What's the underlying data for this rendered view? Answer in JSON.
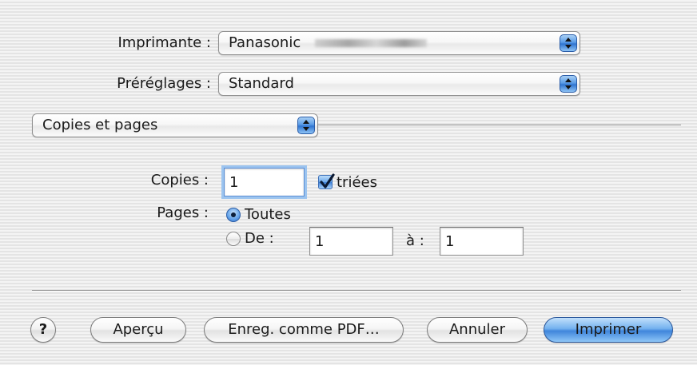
{
  "printer": {
    "label": "Imprimante :",
    "value": "Panasonic"
  },
  "presets": {
    "label": "Préréglages :",
    "value": "Standard"
  },
  "panel_select": {
    "value": "Copies et pages"
  },
  "copies": {
    "label": "Copies :",
    "value": "1",
    "collated_label": "triées",
    "collated_checked": true
  },
  "pages": {
    "label": "Pages :",
    "all_label": "Toutes",
    "all_selected": true,
    "from_label": "De :",
    "from_value": "1",
    "to_label": "à :",
    "to_value": "1"
  },
  "buttons": {
    "help": "?",
    "preview": "Aperçu",
    "save_pdf": "Enreg. comme PDF…",
    "cancel": "Annuler",
    "print": "Imprimer"
  },
  "colors": {
    "accent": "#3f85db",
    "background": "#ececec"
  }
}
